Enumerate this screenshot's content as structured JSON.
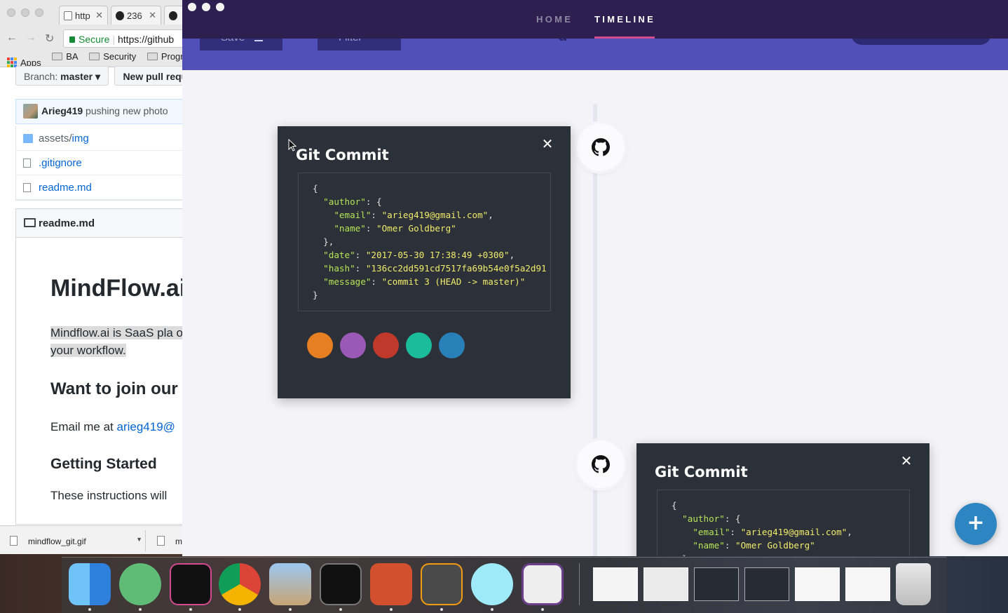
{
  "chrome": {
    "tabs": [
      {
        "label": "http",
        "icon": "page-icon"
      },
      {
        "label": "236",
        "icon": "circle-logo-icon"
      }
    ],
    "address": {
      "secure_label": "Secure",
      "url": "https://github"
    },
    "bookmarks": [
      "Apps",
      "BA",
      "Security",
      "Progra"
    ],
    "branch_label": "Branch:",
    "branch_value": "master",
    "new_pull_request": "New pull requ",
    "commit_author": "Arieg419",
    "commit_message": "pushing new photo",
    "files": [
      {
        "prefix": "assets/",
        "name": "img",
        "type": "folder"
      },
      {
        "prefix": "",
        "name": ".gitignore",
        "type": "file"
      },
      {
        "prefix": "",
        "name": "readme.md",
        "type": "file"
      }
    ],
    "readme_title": "readme.md",
    "readme": {
      "h1": "MindFlow.ai",
      "p1": "Mindflow.ai is SaaS pla on your workflow.",
      "h2": "Want to join our",
      "p2_prefix": "Email me at ",
      "p2_link": "arieg419@",
      "h3": "Getting Started",
      "p3": "These instructions will"
    },
    "downloads": [
      {
        "name": "mindflow_git.gif"
      },
      {
        "name": "my"
      }
    ]
  },
  "app": {
    "nav": {
      "home": "HOME",
      "timeline": "TIMELINE"
    },
    "hero": {
      "save_label": "Save",
      "filter_label": "Filter",
      "title_fragment": "g"
    },
    "cards": [
      {
        "title": "Git Commit",
        "close": "✕",
        "json": {
          "author_key": "\"author\"",
          "email_key": "\"email\"",
          "email_value": "\"arieg419@gmail.com\"",
          "name_key": "\"name\"",
          "name_value": "\"Omer Goldberg\"",
          "date_key": "\"date\"",
          "date_value": "\"2017-05-30 17:38:49 +0300\"",
          "hash_key": "\"hash\"",
          "hash_value": "\"136cc2dd591cd7517fa69b54e0f5a2d91",
          "message_key": "\"message\"",
          "message_value": "\"commit 3 (HEAD -> master)\""
        },
        "swatches": [
          "#e67e22",
          "#9b59b6",
          "#c0392b",
          "#1abc9c",
          "#2980b9"
        ]
      },
      {
        "title": "Git Commit",
        "close": "✕",
        "json": {
          "author_key": "\"author\"",
          "email_key": "\"email\"",
          "email_value": "\"arieg419@gmail.com\"",
          "name_key": "\"name\"",
          "name_value": "\"Omer Goldberg\""
        }
      }
    ],
    "fab": "+",
    "colors": {
      "nav": "#2d1f50",
      "hero": "#5150b8",
      "card": "#2c3038",
      "accent": "#d24a8f",
      "fab": "#2d85c2"
    }
  },
  "dock": {
    "apps": [
      "finder-icon",
      "atom-icon",
      "terminal-icon",
      "chrome-icon",
      "preview-icon",
      "activity-monitor-icon",
      "powerpoint-icon",
      "sublime-text-icon",
      "electron-icon",
      "keyboard-icon"
    ],
    "windows": [
      "window-thumbnail",
      "window-thumbnail",
      "window-thumbnail",
      "window-thumbnail",
      "window-thumbnail",
      "window-thumbnail"
    ],
    "trash": "trash-icon"
  }
}
